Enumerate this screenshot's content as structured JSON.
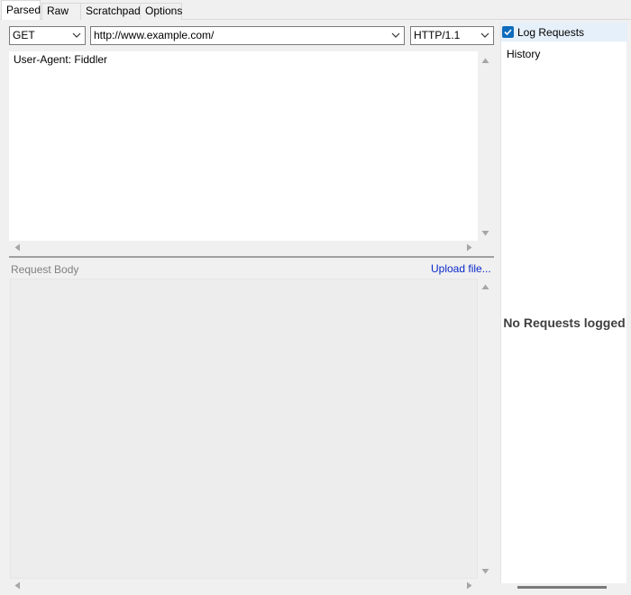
{
  "tabs": [
    {
      "label": "Parsed",
      "active": true
    },
    {
      "label": "Raw",
      "active": false
    },
    {
      "label": "Scratchpad",
      "active": false
    },
    {
      "label": "Options",
      "active": false
    }
  ],
  "request_line": {
    "method": "GET",
    "url": "http://www.example.com/",
    "version": "HTTP/1.1"
  },
  "headers_text": "User-Agent: Fiddler",
  "request_body": {
    "label": "Request Body",
    "upload_link": "Upload file...",
    "content": ""
  },
  "right_panel": {
    "log_requests_label": "Log Requests",
    "log_requests_checked": true,
    "history_label": "History",
    "empty_message": "No Requests logged"
  },
  "colors": {
    "accent": "#0f6cbd",
    "link": "#0a28c8"
  }
}
